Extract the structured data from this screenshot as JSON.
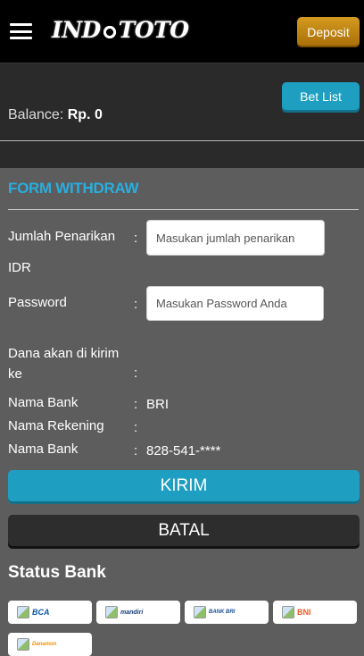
{
  "header": {
    "brand": "INDOTOTO",
    "brand_left": "IND",
    "brand_right": "TOTO",
    "deposit_label": "Deposit"
  },
  "account": {
    "bet_list_label": "Bet List",
    "balance_label": "Balance:",
    "balance_value": "Rp. 0"
  },
  "form": {
    "title": "FORM WITHDRAW",
    "amount_label": "Jumlah Penarikan",
    "amount_placeholder": "Masukan jumlah penarikan",
    "currency": "IDR",
    "password_label": "Password",
    "password_placeholder": "Masukan Password Anda",
    "send_to_label": "Dana akan di kirim ke",
    "colon": ":",
    "bank_label": "Nama Bank",
    "bank_value": "BRI",
    "account_name_label": "Nama Rekening",
    "account_name_value": "",
    "account_number_label": "Nama Bank",
    "account_number_value": "828-541-****",
    "submit_label": "KIRIM",
    "cancel_label": "BATAL"
  },
  "status": {
    "title": "Status Bank",
    "banks": [
      {
        "name": "BCA",
        "color": "#0b5aa8"
      },
      {
        "name": "mandiri",
        "color": "#1a3c7a"
      },
      {
        "name": "BANK BRI",
        "color": "#1b4f9a"
      },
      {
        "name": "BNI",
        "color": "#f15a22"
      },
      {
        "name": "Danamon",
        "color": "#f39200"
      }
    ]
  },
  "colors": {
    "accent": "#1e9fc2",
    "title_accent": "#29aee0",
    "deposit": "#c5880f"
  }
}
